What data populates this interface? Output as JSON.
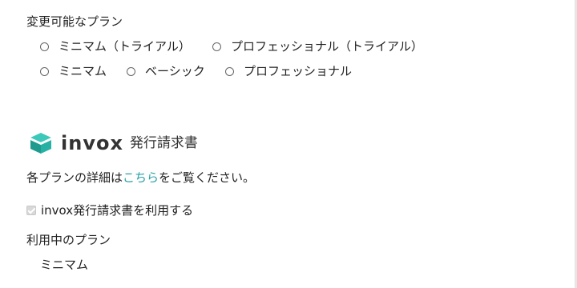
{
  "changeable_plans": {
    "label": "変更可能なプラン",
    "row1": [
      "ミニマム（トライアル）",
      "プロフェッショナル（トライアル）"
    ],
    "row2": [
      "ミニマム",
      "ベーシック",
      "プロフェッショナル"
    ]
  },
  "logo": {
    "icon": "invox-cube-icon",
    "wordmark": "invox",
    "subtitle": "発行請求書",
    "colors": {
      "top": "#34c3b4",
      "side": "#1f8f86"
    }
  },
  "details": {
    "prefix": "各プランの詳細は",
    "link": "こちら",
    "suffix": "をご覧ください。"
  },
  "use_checkbox": {
    "label": "invox発行請求書を利用する",
    "checked": true,
    "disabled": true
  },
  "current_plan": {
    "label": "利用中のプラン",
    "value": "ミニマム"
  }
}
